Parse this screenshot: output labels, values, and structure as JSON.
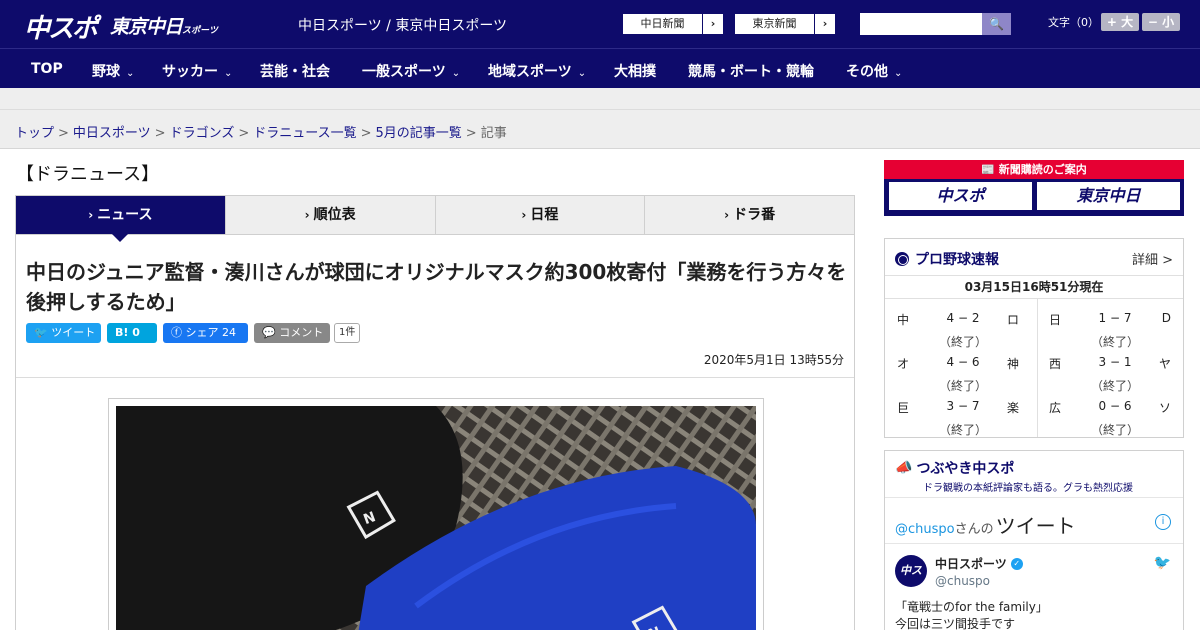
{
  "header": {
    "logo_main": "中スポ",
    "logo_tokyo": "東京中日",
    "logo_tokyo_small": "スポーツ",
    "site_name": "中日スポーツ / 東京中日スポーツ",
    "ext_links": [
      {
        "label": "中日新聞",
        "arrow": "›"
      },
      {
        "label": "東京新聞",
        "arrow": "›"
      }
    ],
    "search_placeholder": "",
    "search_icon": "🔍",
    "font_size_label": "文字（0）",
    "font_up": "+ 大",
    "font_down": "− 小"
  },
  "nav": [
    {
      "label": "TOP",
      "chevron": ""
    },
    {
      "label": "野球",
      "chevron": "⌄"
    },
    {
      "label": "サッカー",
      "chevron": "⌄"
    },
    {
      "label": "芸能・社会",
      "chevron": ""
    },
    {
      "label": "一般スポーツ",
      "chevron": "⌄"
    },
    {
      "label": "地域スポーツ",
      "chevron": "⌄"
    },
    {
      "label": "大相撲",
      "chevron": ""
    },
    {
      "label": "競馬・ボート・競輪",
      "chevron": ""
    },
    {
      "label": "その他",
      "chevron": "⌄"
    }
  ],
  "breadcrumb": {
    "items": [
      "トップ",
      "中日スポーツ",
      "ドラゴンズ",
      "ドラニュース一覧",
      "5月の記事一覧"
    ],
    "separator": ">",
    "current": "記事"
  },
  "main": {
    "section_title": "【ドラニュース】",
    "tabs": [
      {
        "label": "ニュース",
        "arrow": "›"
      },
      {
        "label": "順位表",
        "arrow": "›"
      },
      {
        "label": "日程",
        "arrow": "›"
      },
      {
        "label": "ドラ番",
        "arrow": "›"
      }
    ],
    "headline": "中日のジュニア監督・湊川さんが球団にオリジナルマスク約300枚寄付「業務を行う方々を後押しするため」",
    "share": {
      "tweet": "ツイート",
      "hatena": "B! 0",
      "facebook": "シェア 24",
      "comment": "コメント",
      "comment_count": "1件"
    },
    "date": "2020年5月1日 13時55分"
  },
  "sidebar": {
    "promo": {
      "header": "新聞購読のご案内",
      "btn_left": "中スポ",
      "btn_right": "東京中日"
    },
    "scores": {
      "title": "プロ野球速報",
      "detail": "詳細 >",
      "time": "03月15日16時51分現在",
      "games": [
        {
          "t1": "中",
          "score": "4 − 2",
          "t2": "ロ",
          "status": "（終了）"
        },
        {
          "t1": "オ",
          "score": "4 − 6",
          "t2": "神",
          "status": "（終了）"
        },
        {
          "t1": "巨",
          "score": "3 − 7",
          "t2": "楽",
          "status": "（終了）"
        },
        {
          "t1": "日",
          "score": "1 − 7",
          "t2": "D",
          "status": "（終了）"
        },
        {
          "t1": "西",
          "score": "3 − 1",
          "t2": "ヤ",
          "status": "（終了）"
        },
        {
          "t1": "広",
          "score": "0 − 6",
          "t2": "ソ",
          "status": "（終了）"
        }
      ]
    },
    "twitter": {
      "title": "つぶやき中スポ",
      "subtitle": "ドラ観戦の本紙評論家も語る。グラも熱烈応援",
      "handle_link": "@chuspo",
      "handle_suffix": "さんの",
      "tweet_word": "ツイート",
      "info": "i",
      "avatar_text": "中スポ",
      "account_name": "中日スポーツ",
      "account_at": "@chuspo",
      "tweet_line1": "「竜戦士のfor the family」",
      "tweet_line2": "今回は三ツ間投手です"
    }
  }
}
